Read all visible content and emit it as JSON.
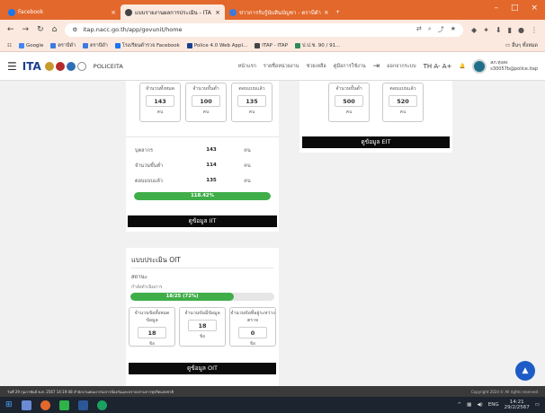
{
  "browser": {
    "tabs": [
      {
        "title": "Facebook",
        "color": "#1877f2",
        "active": false
      },
      {
        "title": "แบบรายงานผลการประเมิน - ITA",
        "color": "#444444",
        "active": true
      },
      {
        "title": "ข่าวการรับรู้นับสินบัญชา - ตราบีดำ",
        "color": "#3b7be0",
        "active": false
      }
    ],
    "new_tab": "+",
    "window_controls": [
      "–",
      "□",
      "×"
    ],
    "url": "itap.nacc.go.th/app/govunit/home",
    "bookmarks": [
      {
        "label": "Google",
        "color": "#4285f4"
      },
      {
        "label": "ตราบีดำ",
        "color": "#3b7be0"
      },
      {
        "label": "ตราบีดำ",
        "color": "#3b7be0"
      },
      {
        "label": "โรงเรียนตำรวจ Facebook",
        "color": "#1877f2"
      },
      {
        "label": "Police 4.0 Web Appl...",
        "color": "#1a3f8f"
      },
      {
        "label": "ITAP - ITAP",
        "color": "#444444"
      },
      {
        "label": "ป.ป.ช. 90 / 91...",
        "color": "#2e8b57"
      }
    ],
    "bookmarks_right": "อื่นๆ ทั้งหมด"
  },
  "site": {
    "logo_text": "ITA",
    "brand": "POLICEITA",
    "nav": [
      "หน้าแรก",
      "รายชื่อหน่วยงาน",
      "ช่วยเหลือ",
      "คู่มือการใช้งาน"
    ],
    "login": "ออกจากระบบ",
    "font_size_controls": "TH  A-  A+",
    "user_name": "สภ.ทุ่งสง",
    "user_email": "s30057b@police.itap"
  },
  "iit": {
    "boxes": [
      {
        "label": "จำนวนทั้งหมด",
        "value": "143",
        "unit": "คน"
      },
      {
        "label": "จำนวนขั้นต่ำ",
        "value": "100",
        "unit": "คน"
      },
      {
        "label": "ตอบแบบแล้ว",
        "value": "135",
        "unit": "คน"
      }
    ],
    "rows": [
      {
        "k": "บุคลากร",
        "v": "143",
        "u": "คน"
      },
      {
        "k": "จำนวนขั้นต่ำ",
        "v": "114",
        "u": "คน"
      },
      {
        "k": "ตอบแบบแล้ว",
        "v": "135",
        "u": "คน"
      }
    ],
    "progress_label": "118.42%",
    "progress_value": 100,
    "button": "ดูข้อมูล IIT"
  },
  "eit": {
    "boxes": [
      {
        "label": "จำนวนขั้นต่ำ",
        "value": "500",
        "unit": "คน"
      },
      {
        "label": "ตอบแบบแล้ว",
        "value": "520",
        "unit": "คน"
      }
    ],
    "button": "ดูข้อมูล EIT"
  },
  "oit": {
    "title": "แบบประเมิน OIT",
    "status_label": "สถานะ",
    "status_value": "กำลังดำเนินการ",
    "progress_label": "18/25 (72%)",
    "progress_value": 72,
    "boxes": [
      {
        "label": "จำนวนข้อทั้งหมดข้อมูล",
        "value": "18",
        "unit": "ข้อ"
      },
      {
        "label": "จำนวนข้อมีข้อมูล",
        "value": "18",
        "unit": "ข้อ"
      },
      {
        "label": "จำนวนข้อที่อยู่ระหว่างตรวจ",
        "value": "0",
        "unit": "ข้อ"
      }
    ],
    "button": "ดูข้อมูล OIT"
  },
  "scroll_top": "▲",
  "statusbar": {
    "left": "วันที่ 29 กุมภาพันธ์ พ.ศ. 2567  14:19:48  สำนักงานคณะกรรมการป้องกันและปราบปรามการทุจริตแห่งชาติ",
    "right": "Copyright 2024 © All rights reserved"
  },
  "taskbar": {
    "lang": "ENG",
    "time": "14:21",
    "date": "29/2/2567"
  },
  "colors": {
    "brand_orange": "#e3682b",
    "progress_green": "#3fae49",
    "header_blue": "#1a3f8f",
    "button_black": "#0b0b0b"
  }
}
